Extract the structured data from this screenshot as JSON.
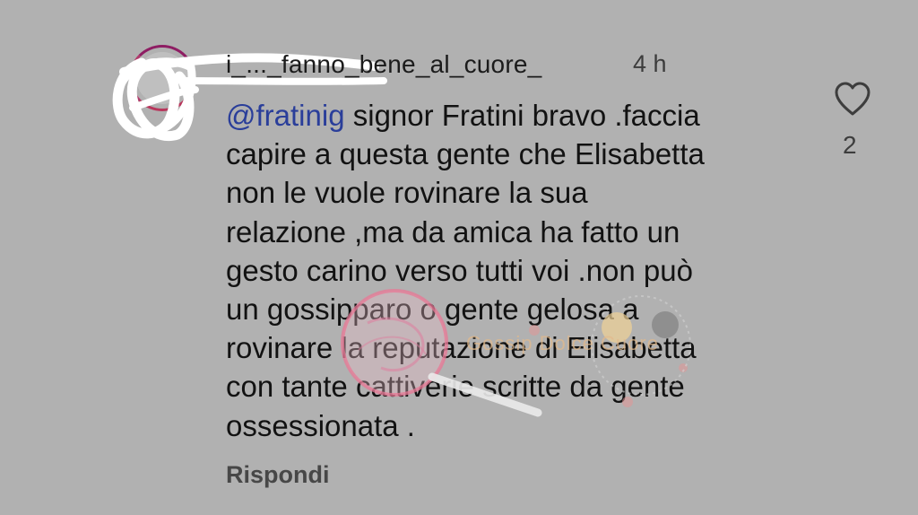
{
  "comment": {
    "username": "i_..._fanno_bene_al_cuore_",
    "timestamp": "4 h",
    "mention": "@fratinig",
    "lines": [
      " signor Fratini bravo .faccia",
      "capire a questa gente che Elisabetta",
      "non le vuole rovinare la sua",
      "relazione ,ma da amica ha fatto un",
      "gesto carino verso tutti voi .non può",
      "un gossipparo o gente gelosa a",
      "rovinare la reputazione di Elisabetta",
      "con tante cattiverie scritte da gente",
      "ossessionata ."
    ],
    "like_count": "2",
    "reply_label": "Rispondi",
    "like_icon": "heart-outline-icon"
  },
  "watermark": {
    "text": "Gossip Dolce Cuore"
  },
  "colors": {
    "background": "#b1b1b1",
    "mention": "#2a3e9a",
    "avatar_ring": "#8e1d63",
    "redaction": "#ffffff"
  }
}
